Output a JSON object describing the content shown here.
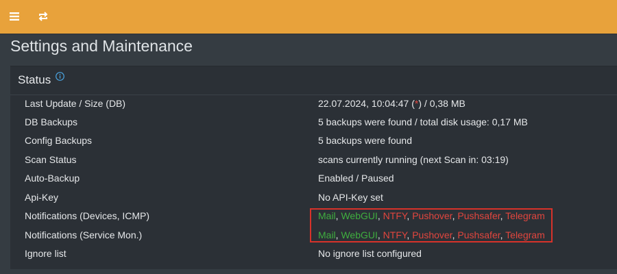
{
  "topbar": {
    "menu_icon": "hamburger-menu-icon",
    "refresh_icon": "refresh-icon"
  },
  "page": {
    "title": "Settings and Maintenance"
  },
  "status": {
    "header": "Status",
    "info_icon": "info-icon",
    "rows": [
      {
        "label": "Last Update / Size (DB)",
        "value_prefix": "22.07.2024, 10:04:47 (",
        "value_star": "*",
        "value_suffix": ") / 0,38 MB"
      },
      {
        "label": "DB Backups",
        "value": "5 backups were found / total disk usage: 0,17 MB"
      },
      {
        "label": "Config Backups",
        "value": "5 backups were found"
      },
      {
        "label": "Scan Status",
        "value": "scans currently running (next Scan in: 03:19)"
      },
      {
        "label": "Auto-Backup",
        "value": "Enabled / Paused"
      },
      {
        "label": "Api-Key",
        "value": "No API-Key set"
      },
      {
        "label": "Notifications (Devices, ICMP)"
      },
      {
        "label": "Notifications (Service Mon.)"
      },
      {
        "label": "Ignore list",
        "value": "No ignore list configured"
      }
    ],
    "notifications": {
      "mail": "Mail",
      "webgui": "WebGUI",
      "ntfy": "NTFY",
      "pushover": "Pushover",
      "pushsafer": "Pushsafer",
      "telegram": "Telegram",
      "separator": ", "
    },
    "colors": {
      "enabled": "#3fae3f",
      "disabled": "#e2463e",
      "highlight": "#d8322a"
    }
  }
}
